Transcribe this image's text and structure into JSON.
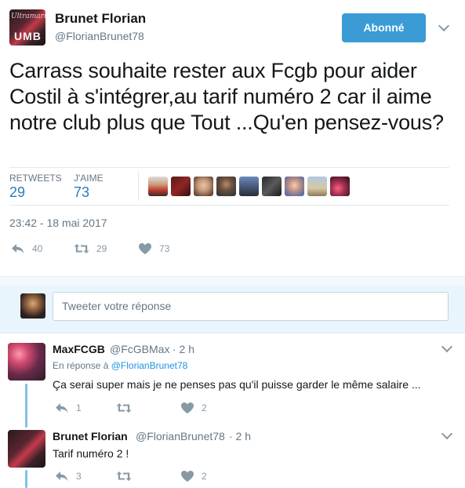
{
  "tweet": {
    "author_name": "Brunet Florian",
    "author_handle": "@FlorianBrunet78",
    "avatar_text_small": "Ultramarines",
    "avatar_text_big": "UMB",
    "follow_label": "Abonné",
    "text": "Carrass souhaite rester aux Fcgb pour aider Costil à s'intégrer,au tarif numéro 2 car il aime notre club plus que Tout ...Qu'en pensez-vous?",
    "retweets_label": "RETWEETS",
    "retweets_count": "29",
    "likes_label": "J'AIME",
    "likes_count": "73",
    "timestamp": "23:42 - 18 mai 2017",
    "actions": {
      "reply_count": "40",
      "retweet_count": "29",
      "like_count": "73"
    },
    "liker_avatars": [
      "liker-1",
      "liker-2",
      "liker-3",
      "liker-4",
      "liker-5",
      "liker-6",
      "liker-7",
      "liker-8",
      "liker-9"
    ]
  },
  "reply_composer": {
    "placeholder": "Tweeter votre réponse"
  },
  "replies": [
    {
      "name": "MaxFCGB",
      "handle": "@FcGBMax",
      "time": "· 2 h",
      "in_reply_prefix": "En réponse à",
      "in_reply_handle": "@FlorianBrunet78",
      "text": "Ça serai super mais je ne penses pas qu'il puisse garder le même salaire ...",
      "reply_count": "1",
      "retweet_count": "",
      "like_count": "2"
    },
    {
      "name": "Brunet Florian",
      "handle": "@FlorianBrunet78",
      "time": "· 2 h",
      "text": "Tarif numéro 2 !",
      "reply_count": "3",
      "retweet_count": "",
      "like_count": "2"
    }
  ],
  "colors": {
    "accent": "#3a9bd5",
    "link": "#1b95e0",
    "muted": "#657786",
    "icon": "#8899a6"
  }
}
